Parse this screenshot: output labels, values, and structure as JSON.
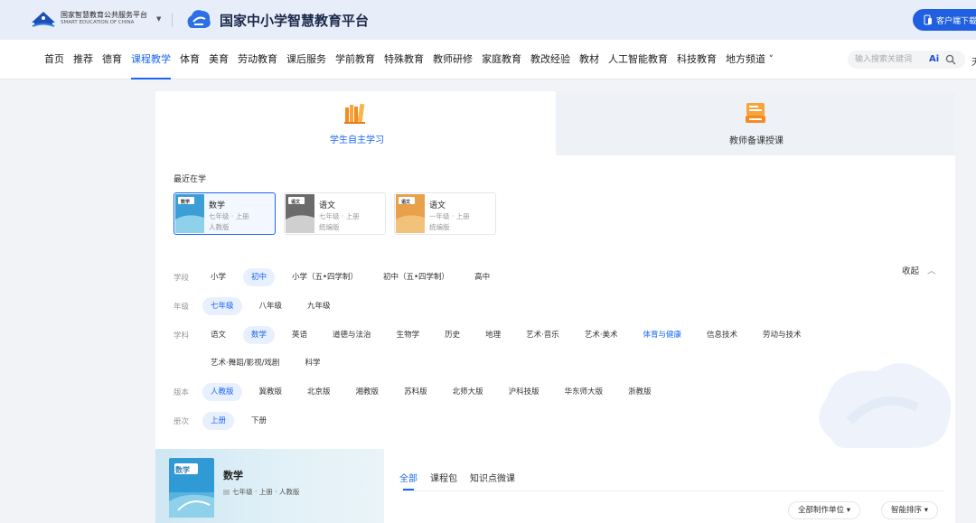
{
  "header": {
    "portal_name": "国家智慧教育公共服务平台",
    "portal_name_en": "SMART EDUCATION OF CHINA",
    "brand_title": "国家中小学智慧教育平台",
    "client_download": "客户端下载",
    "brand_color": "#1f5fe0"
  },
  "nav": {
    "items": [
      "首页",
      "推荐",
      "德育",
      "课程教学",
      "体育",
      "美育",
      "劳动教育",
      "课后服务",
      "学前教育",
      "特殊教育",
      "教师研修",
      "家庭教育",
      "教改经验",
      "教材",
      "人工智能教育",
      "科技教育",
      "地方频道 ˅"
    ],
    "active_index": 3,
    "search_placeholder": "输入搜索关键词",
    "ai_label": "Ai",
    "overflow_char": "天"
  },
  "tabs": {
    "student": "学生自主学习",
    "teacher": "教师备课授课",
    "accent": "#1a66f0"
  },
  "recent": {
    "title": "最近在学",
    "cards": [
      {
        "subject": "数学",
        "grade": "七年级 · 上册",
        "edition": "人教版",
        "cover_text": "数学"
      },
      {
        "subject": "语文",
        "grade": "七年级 · 上册",
        "edition": "统编版",
        "cover_text": "语文"
      },
      {
        "subject": "语文",
        "grade": "一年级 · 上册",
        "edition": "统编版",
        "cover_text": "语文"
      }
    ]
  },
  "filters": {
    "collapse_label": "收起",
    "rows": [
      {
        "label": "学段",
        "options": [
          "小学",
          "初中",
          "小学（五•四学制）",
          "初中（五•四学制）",
          "高中"
        ],
        "selected": 1
      },
      {
        "label": "年级",
        "options": [
          "七年级",
          "八年级",
          "九年级"
        ],
        "selected": 0
      },
      {
        "label": "学科",
        "options": [
          "语文",
          "数学",
          "英语",
          "道德与法治",
          "生物学",
          "历史",
          "地理",
          "艺术·音乐",
          "艺术·美术",
          "体育与健康",
          "信息技术",
          "劳动与技术"
        ],
        "selected": 1,
        "highlight": 9
      },
      {
        "label": "",
        "options": [
          "艺术·舞蹈/影视/戏剧",
          "科学"
        ],
        "selected": -1
      },
      {
        "label": "版本",
        "options": [
          "人教版",
          "冀教版",
          "北京版",
          "湘教版",
          "苏科版",
          "北师大版",
          "沪科技版",
          "华东师大版",
          "浙教版"
        ],
        "selected": 0
      },
      {
        "label": "册次",
        "options": [
          "上册",
          "下册"
        ],
        "selected": 0
      }
    ]
  },
  "book": {
    "title": "数学",
    "subtitle": "七年级 · 上册 · 人教版",
    "cover_text": "数学"
  },
  "resource_tabs": [
    "全部",
    "课程包",
    "知识点微课"
  ],
  "dropdowns": {
    "unit": "全部制作单位 ▾",
    "sort": "智能排序 ▾"
  }
}
